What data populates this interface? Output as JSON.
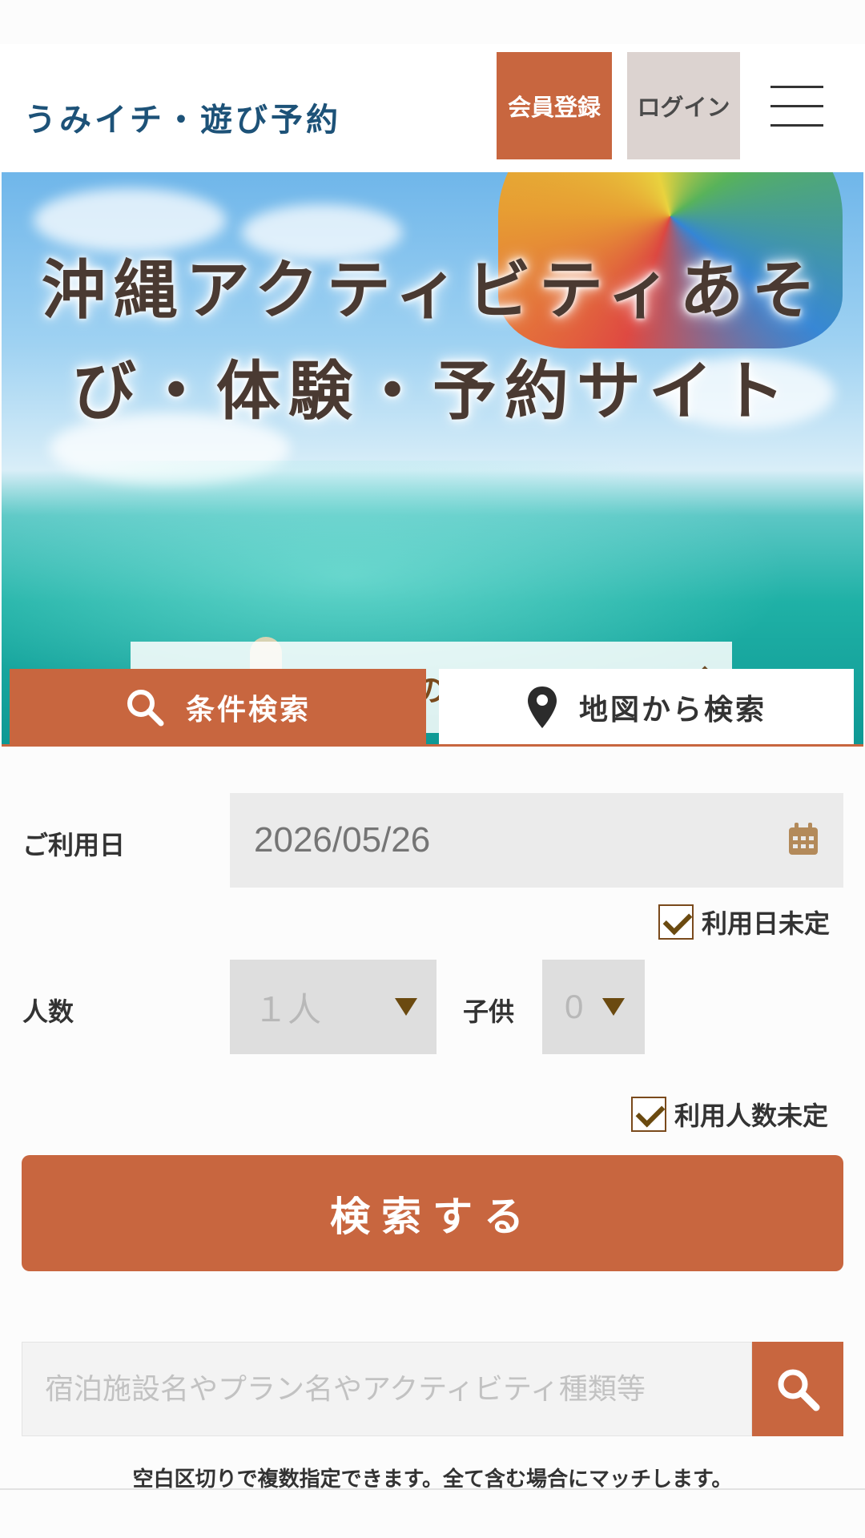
{
  "header": {
    "logo": "うみイチ・遊び予約",
    "register_label": "会員登録",
    "login_label": "ログイン",
    "menu_icon": "hamburger-menu-icon"
  },
  "hero": {
    "title_line1": "沖縄アクティビティあそ",
    "title_line2": "び・体験・予約サイト",
    "feature_button": "島人の厳選"
  },
  "tabs": [
    {
      "label": "条件検索",
      "icon": "search-icon",
      "active": true
    },
    {
      "label": "地図から検索",
      "icon": "map-pin-icon",
      "active": false
    }
  ],
  "form": {
    "date_label": "ご利用日",
    "date_placeholder": "2026/05/26",
    "date_undecided_label": "利用日未定",
    "people_label": "人数",
    "adults_value": "１人",
    "children_label": "子供",
    "children_value": "0",
    "people_undecided_label": "利用人数未定",
    "submit_label": "検索する"
  },
  "keyword": {
    "placeholder": "宿泊施設名やプラン名やアクティビティ種類等",
    "hint": "空白区切りで複数指定できます。全て含む場合にマッチします。"
  },
  "colors": {
    "accent": "#c8663f",
    "logo": "#1d5278",
    "login_bg": "#dcd3d0"
  }
}
